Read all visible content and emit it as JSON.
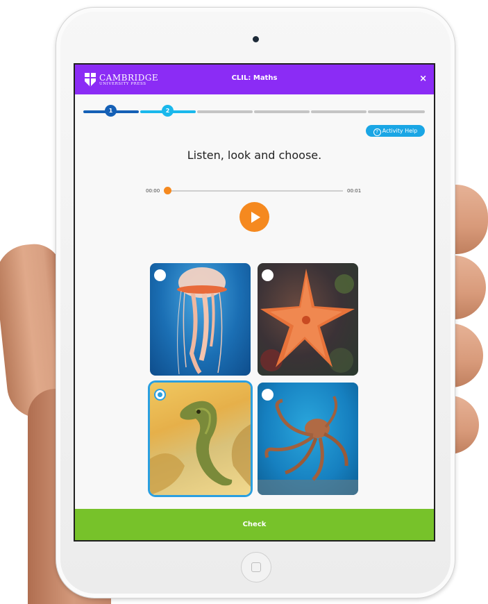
{
  "header": {
    "logo_main": "CAMBRIDGE",
    "logo_sub": "UNIVERSITY PRESS",
    "title": "CLIL: Maths",
    "close_label": "×"
  },
  "progress": {
    "steps": [
      "1",
      "2"
    ],
    "total_segments": 6,
    "current_step": 2
  },
  "help": {
    "label": "Activity Help",
    "icon": "?"
  },
  "activity": {
    "instruction": "Listen, look and choose.",
    "audio": {
      "current_time": "00:00",
      "total_time": "00:01",
      "progress": 0
    },
    "choices": [
      {
        "subject": "jellyfish",
        "selected": false
      },
      {
        "subject": "starfish",
        "selected": false
      },
      {
        "subject": "seahorse",
        "selected": true
      },
      {
        "subject": "octopus",
        "selected": false
      }
    ]
  },
  "footer": {
    "check_label": "Check"
  },
  "colors": {
    "header_bg": "#8b2cf5",
    "step_done": "#1560b6",
    "step_current": "#1ab8ec",
    "audio_accent": "#f5891f",
    "selected_accent": "#2a9fe0",
    "check_bg": "#77c22a"
  }
}
